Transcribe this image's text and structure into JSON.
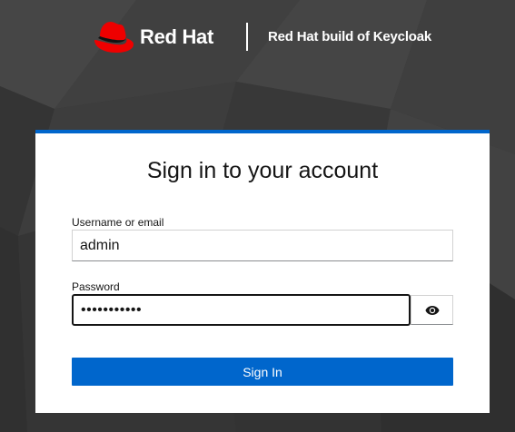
{
  "header": {
    "brand_name": "Red Hat",
    "product_name": "Red Hat build of Keycloak",
    "icons": {
      "logo": "red-hat-fedora-icon"
    }
  },
  "login": {
    "title": "Sign in to your account",
    "username_label": "Username or email",
    "username_value": "admin",
    "password_label": "Password",
    "password_value_masked": "•••••••••••",
    "show_password_icon": "eye-icon",
    "submit_label": "Sign In"
  },
  "colors": {
    "brand_red": "#ee0000",
    "accent_blue": "#0066cc",
    "background_dark": "#3a3a3a",
    "text_primary": "#151515"
  }
}
